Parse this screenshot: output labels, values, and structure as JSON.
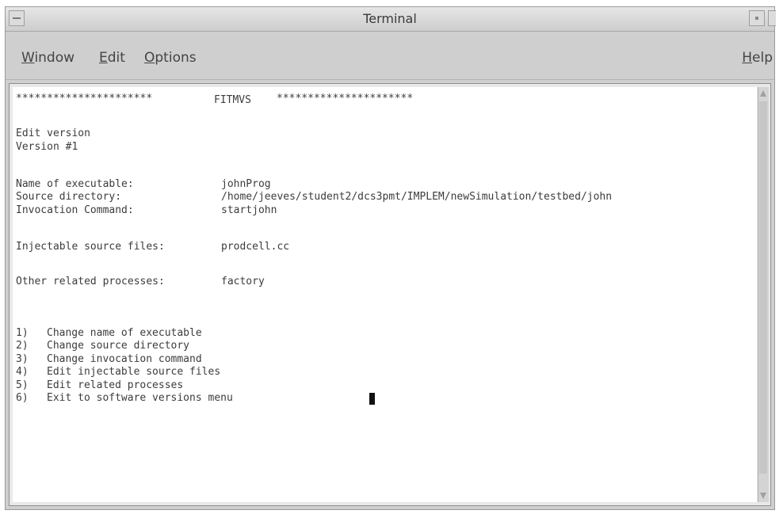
{
  "window": {
    "title": "Terminal"
  },
  "menubar": {
    "items": [
      {
        "label_first": "W",
        "label_rest": "indow"
      },
      {
        "label_first": "E",
        "label_rest": "dit"
      },
      {
        "label_first": "O",
        "label_rest": "ptions"
      }
    ],
    "help": {
      "label_first": "H",
      "label_rest": "elp"
    }
  },
  "terminal": {
    "header_stars_left": "**********************",
    "header_title": "FITMVS",
    "header_stars_right": "**********************",
    "mode": "Edit version",
    "version": "Version #1",
    "fields": [
      {
        "label": "Name of executable:",
        "value": "johnProg"
      },
      {
        "label": "Source directory:",
        "value": "/home/jeeves/student2/dcs3pmt/IMPLEM/newSimulation/testbed/john"
      },
      {
        "label": "Invocation Command:",
        "value": "startjohn"
      }
    ],
    "injectable": {
      "label": "Injectable source files:",
      "value": "prodcell.cc"
    },
    "related": {
      "label": "Other related processes:",
      "value": "factory"
    },
    "options": [
      {
        "num": "1)",
        "text": "Change name of executable"
      },
      {
        "num": "2)",
        "text": "Change source directory"
      },
      {
        "num": "3)",
        "text": "Change invocation command"
      },
      {
        "num": "4)",
        "text": "Edit injectable source files"
      },
      {
        "num": "5)",
        "text": "Edit related processes"
      },
      {
        "num": "6)",
        "text": "Exit to software versions menu"
      }
    ]
  }
}
